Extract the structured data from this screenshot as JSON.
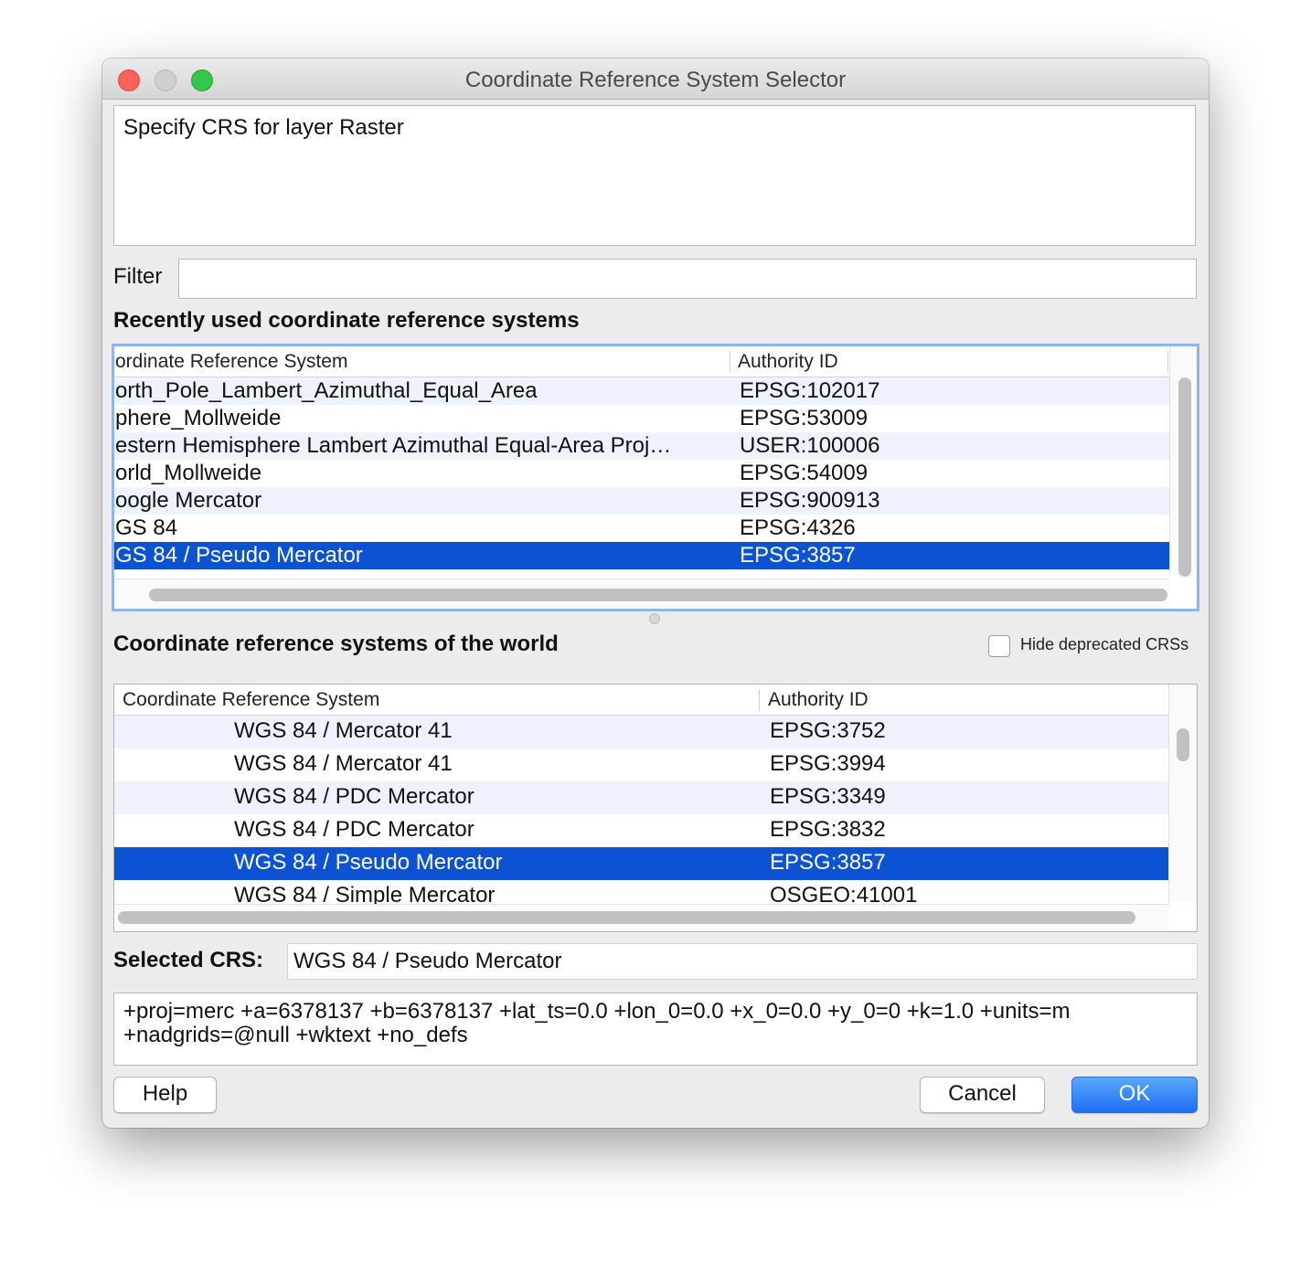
{
  "window": {
    "title": "Coordinate Reference System Selector"
  },
  "info_text": "Specify CRS for layer Raster",
  "filter": {
    "label": "Filter",
    "value": ""
  },
  "recent": {
    "heading": "Recently used coordinate reference systems",
    "col_crs": "ordinate Reference System",
    "col_auth": "Authority ID",
    "rows": [
      {
        "name": "orth_Pole_Lambert_Azimuthal_Equal_Area",
        "auth": "EPSG:102017"
      },
      {
        "name": "phere_Mollweide",
        "auth": "EPSG:53009"
      },
      {
        "name": "estern Hemisphere Lambert Azimuthal Equal-Area Proj…",
        "auth": "USER:100006"
      },
      {
        "name": "orld_Mollweide",
        "auth": "EPSG:54009"
      },
      {
        "name": "oogle Mercator",
        "auth": "EPSG:900913"
      },
      {
        "name": "GS 84",
        "auth": "EPSG:4326"
      },
      {
        "name": "GS 84 / Pseudo Mercator",
        "auth": "EPSG:3857"
      }
    ],
    "selected_index": 6
  },
  "world": {
    "heading": "Coordinate reference systems of the world",
    "hide_deprecated_label": "Hide deprecated CRSs",
    "hide_deprecated_checked": false,
    "col_crs": "Coordinate Reference System",
    "col_auth": "Authority ID",
    "rows": [
      {
        "name": "WGS 84 / Mercator 41",
        "auth": "EPSG:3752"
      },
      {
        "name": "WGS 84 / Mercator 41",
        "auth": "EPSG:3994"
      },
      {
        "name": "WGS 84 / PDC Mercator",
        "auth": "EPSG:3349"
      },
      {
        "name": "WGS 84 / PDC Mercator",
        "auth": "EPSG:3832"
      },
      {
        "name": "WGS 84 / Pseudo Mercator",
        "auth": "EPSG:3857"
      },
      {
        "name": "WGS 84 / Simple Mercator",
        "auth": "OSGEO:41001"
      }
    ],
    "selected_index": 4
  },
  "selected_crs": {
    "label": "Selected CRS:",
    "value": "WGS 84 / Pseudo Mercator"
  },
  "proj_string": "+proj=merc +a=6378137 +b=6378137 +lat_ts=0.0 +lon_0=0.0 +x_0=0.0 +y_0=0 +k=1.0 +units=m +nadgrids=@null +wktext  +no_defs",
  "buttons": {
    "help": "Help",
    "cancel": "Cancel",
    "ok": "OK"
  },
  "colors": {
    "selection": "#0c53d4",
    "alt_row": "#edf2fc",
    "ok_button": "#1c6ff5"
  }
}
